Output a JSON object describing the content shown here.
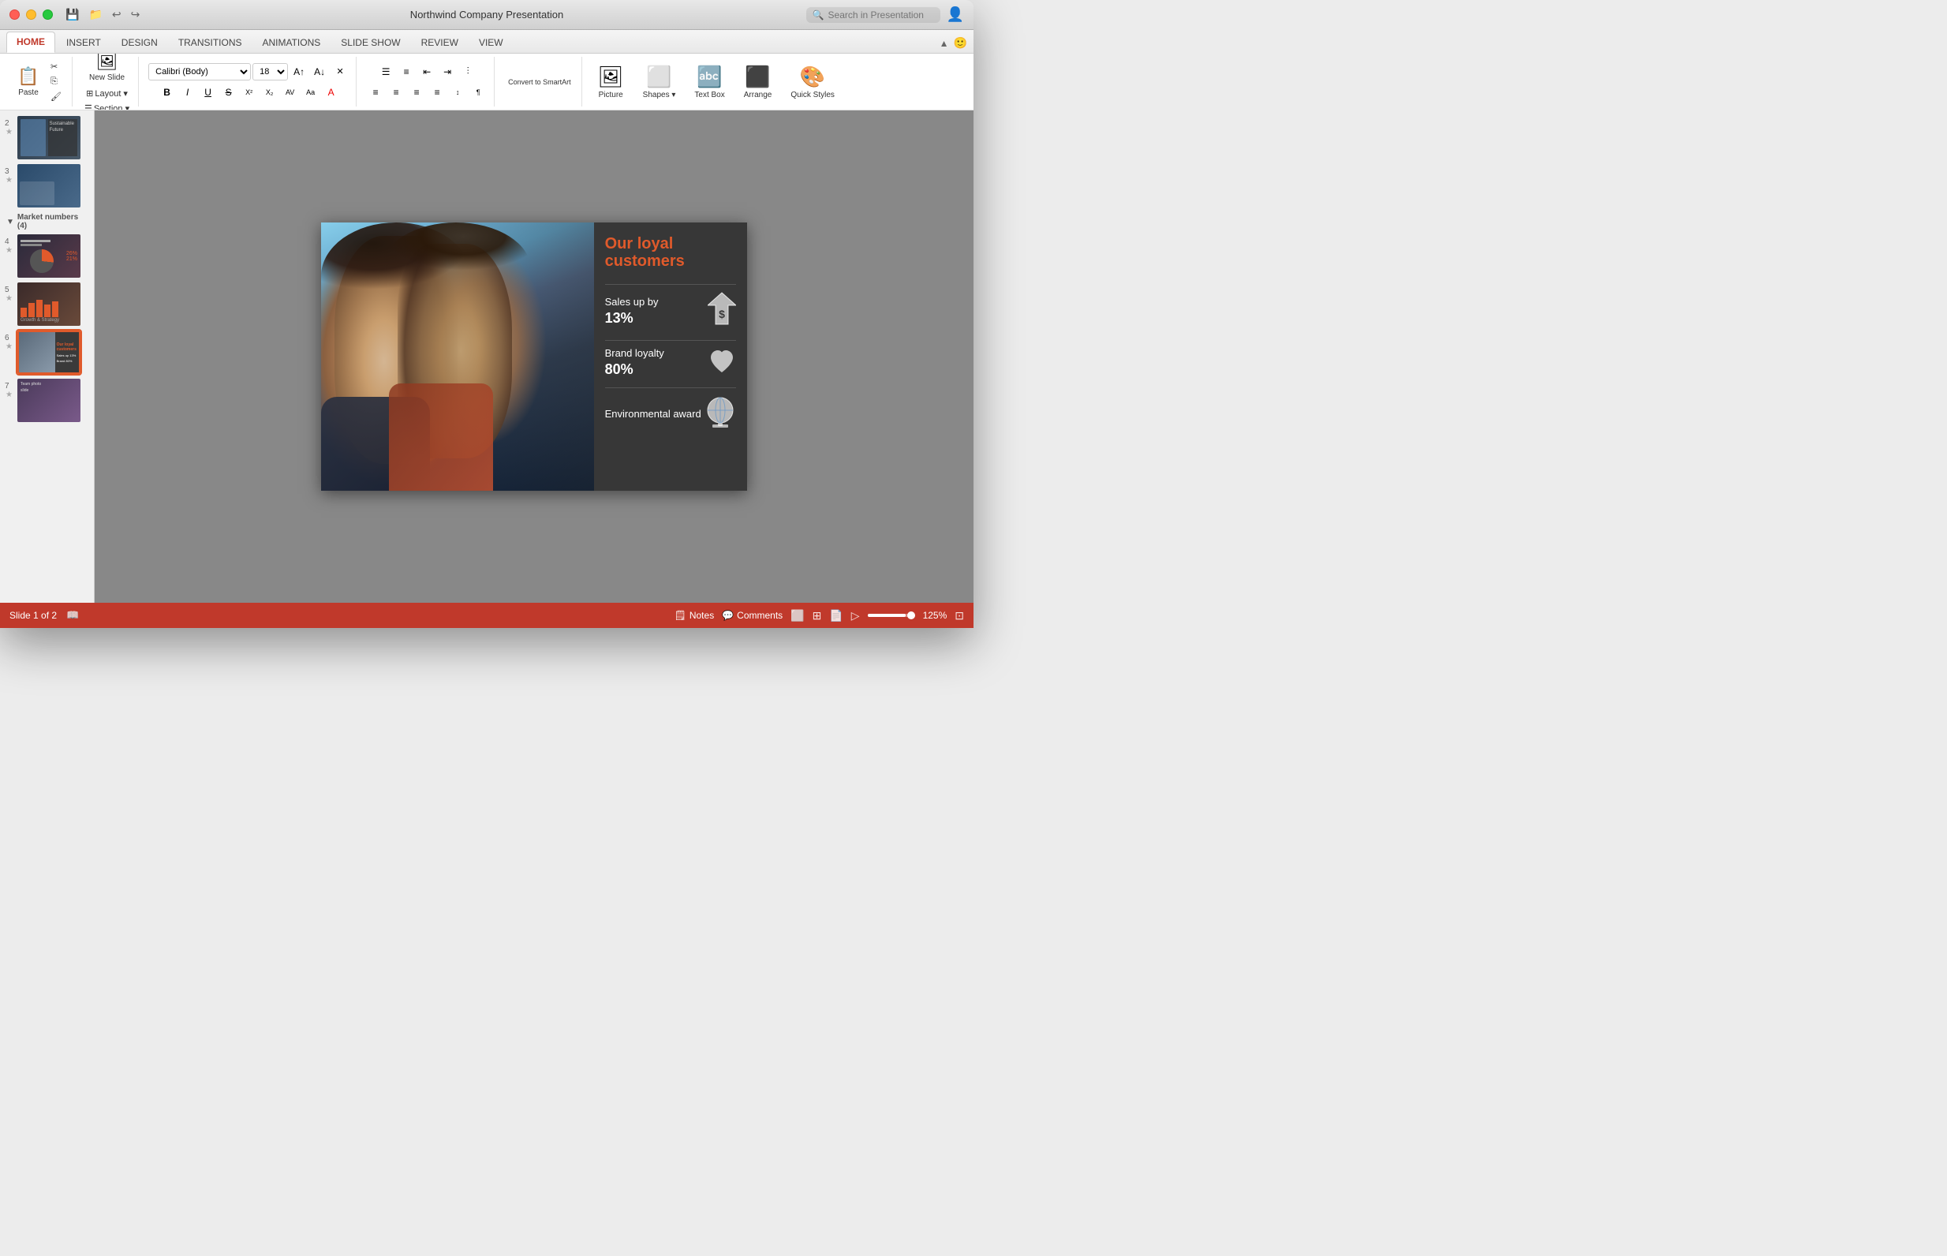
{
  "titlebar": {
    "title": "Northwind Company Presentation",
    "search_placeholder": "Search in Presentation"
  },
  "tabs": [
    {
      "id": "home",
      "label": "HOME",
      "active": true
    },
    {
      "id": "insert",
      "label": "INSERT",
      "active": false
    },
    {
      "id": "design",
      "label": "DESIGN",
      "active": false
    },
    {
      "id": "transitions",
      "label": "TRANSITIONS",
      "active": false
    },
    {
      "id": "animations",
      "label": "ANIMATIONS",
      "active": false
    },
    {
      "id": "slideshow",
      "label": "SLIDE SHOW",
      "active": false
    },
    {
      "id": "review",
      "label": "REVIEW",
      "active": false
    },
    {
      "id": "view",
      "label": "VIEW",
      "active": false
    }
  ],
  "toolbar": {
    "paste_label": "Paste",
    "new_slide_label": "New Slide",
    "layout_label": "Layout ▾",
    "section_label": "Section ▾",
    "font_family": "Calibri (Body)",
    "font_size": "18",
    "bold_label": "B",
    "italic_label": "I",
    "underline_label": "U",
    "convert_smartart": "Convert to SmartArt",
    "picture_label": "Picture",
    "textbox_label": "Text Box",
    "arrange_label": "Arrange",
    "quick_styles_label": "Quick Styles",
    "shapes_label": "Shapes ▾"
  },
  "slide_panel": {
    "slides": [
      {
        "num": "2",
        "starred": true,
        "thumb_class": "thumb-1"
      },
      {
        "num": "3",
        "starred": true,
        "thumb_class": "thumb-2"
      },
      {
        "num": "4",
        "starred": true,
        "thumb_class": "thumb-4"
      },
      {
        "num": "5",
        "starred": true,
        "thumb_class": "thumb-5"
      },
      {
        "num": "6",
        "starred": true,
        "thumb_class": "thumb-6",
        "active": true
      },
      {
        "num": "7",
        "starred": true,
        "thumb_class": "thumb-7"
      }
    ],
    "section_label": "Market numbers (4)"
  },
  "slide": {
    "title": "Our loyal customers",
    "stat1_text": "Sales up by",
    "stat1_num": "13%",
    "stat2_text": "Brand loyalty",
    "stat2_num": "80%",
    "stat3_text": "Environmental award",
    "stat1_icon": "💲",
    "stat2_icon": "♥",
    "stat3_icon": "🌍"
  },
  "statusbar": {
    "slide_info": "Slide 1 of 2",
    "notes_label": "Notes",
    "comments_label": "Comments",
    "zoom_level": "125%"
  }
}
